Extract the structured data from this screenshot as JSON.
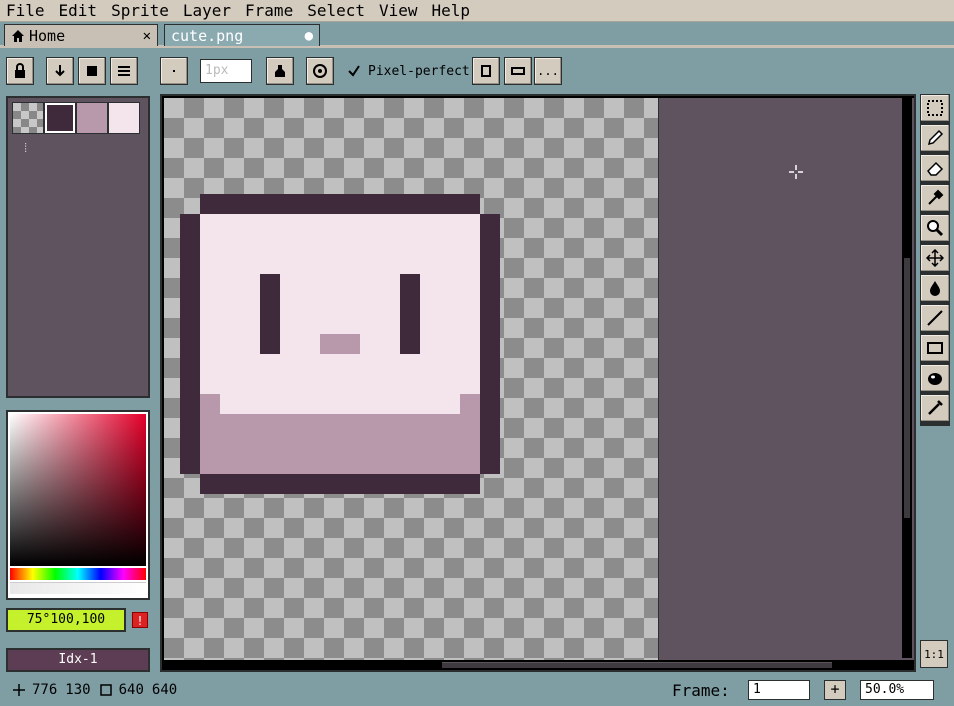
{
  "menubar": {
    "items": [
      "File",
      "Edit",
      "Sprite",
      "Layer",
      "Frame",
      "Select",
      "View",
      "Help"
    ]
  },
  "tabs": {
    "home": {
      "label": "Home",
      "close": "✕"
    },
    "file": {
      "label": "cute.png",
      "modified": "●"
    }
  },
  "toolbar": {
    "brush_size_placeholder": "1px",
    "pixel_perfect_label": "Pixel-perfect",
    "pixel_perfect_checked": true,
    "more_label": "..."
  },
  "palette": {
    "swatches": [
      "transparent",
      "#3f2a3c",
      "#b799ab",
      "#f4e4ec"
    ],
    "selected_index": 1
  },
  "color": {
    "value": "75°100,100",
    "warning": "!",
    "index": "Idx-1"
  },
  "sprite": {
    "dark": "#3f2a3c",
    "light": "#f4e4ec",
    "mid": "#b799ab"
  },
  "status": {
    "cursor_x": "776",
    "cursor_y": "130",
    "width": "640",
    "height": "640",
    "frame_label": "Frame:",
    "frame_value": "1",
    "frame_add": "+",
    "zoom": "50.0%"
  },
  "one_to_one": "1:1"
}
